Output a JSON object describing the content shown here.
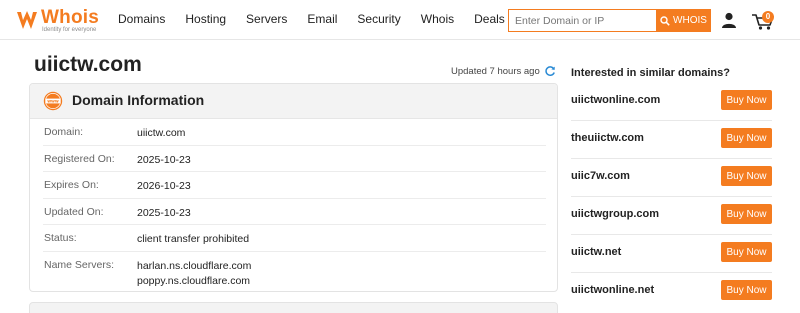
{
  "brand": {
    "name": "Whois",
    "tagline": "Identity for everyone",
    "accent_color": "#f47c20"
  },
  "nav": {
    "items": [
      {
        "label": "Domains"
      },
      {
        "label": "Hosting"
      },
      {
        "label": "Servers"
      },
      {
        "label": "Email"
      },
      {
        "label": "Security"
      },
      {
        "label": "Whois"
      },
      {
        "label": "Deals"
      }
    ]
  },
  "search": {
    "placeholder": "Enter Domain or IP",
    "value": "",
    "button_label": "WHOIS",
    "button_icon": "search-icon"
  },
  "header_icons": {
    "user": "user-icon",
    "cart": "cart-icon",
    "cart_count": "0"
  },
  "page": {
    "domain": "uiictw.com",
    "updated_text": "Updated 7 hours ago",
    "refresh_icon": "refresh-icon"
  },
  "domain_info": {
    "title": "Domain Information",
    "icon": "www-icon",
    "rows": [
      {
        "label": "Domain:",
        "value": "uiictw.com"
      },
      {
        "label": "Registered On:",
        "value": "2025-10-23"
      },
      {
        "label": "Expires On:",
        "value": "2026-10-23"
      },
      {
        "label": "Updated On:",
        "value": "2025-10-23"
      },
      {
        "label": "Status:",
        "value": "client transfer prohibited"
      },
      {
        "label": "Name Servers:",
        "values": [
          "harlan.ns.cloudflare.com",
          "poppy.ns.cloudflare.com"
        ]
      }
    ]
  },
  "suggestions": {
    "heading": "Interested in similar domains?",
    "button_label": "Buy Now",
    "items": [
      {
        "domain": "uiictwonline.com"
      },
      {
        "domain": "theuiictw.com"
      },
      {
        "domain": "uiic7w.com"
      },
      {
        "domain": "uiictwgroup.com"
      },
      {
        "domain": "uiictw.net"
      },
      {
        "domain": "uiictwonline.net"
      }
    ]
  }
}
